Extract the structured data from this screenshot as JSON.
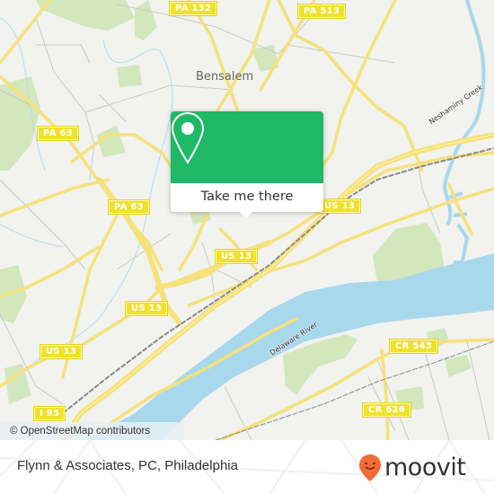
{
  "map": {
    "place_labels": [
      {
        "name": "Bensalem"
      }
    ],
    "water_labels": [
      {
        "name": "Neshaminy Creek"
      },
      {
        "name": "Delaware River"
      }
    ],
    "road_shields": [
      {
        "label": "PA 132"
      },
      {
        "label": "PA 513"
      },
      {
        "label": "PA 63"
      },
      {
        "label": "PA 63"
      },
      {
        "label": "US 13"
      },
      {
        "label": "US 13"
      },
      {
        "label": "US 13"
      },
      {
        "label": "US 13"
      },
      {
        "label": "I 95"
      },
      {
        "label": "CR 543"
      },
      {
        "label": "CR 626"
      }
    ],
    "attribution": "© OpenStreetMap contributors",
    "colors": {
      "land": "#f2f2ef",
      "water": "#a8d8ec",
      "park": "#cfe6b4",
      "road_major": "#f5e27a",
      "road_minor": "#c9c9c5",
      "rail": "#8a8a8a"
    }
  },
  "popup": {
    "icon": "map-pin-icon",
    "button_label": "Take me there",
    "accent_color": "#1fb866"
  },
  "footer": {
    "title": "Flynn & Associates, PC, Philadelphia",
    "brand": {
      "name": "moovit",
      "icon": "moovit-pin-smile-icon",
      "color": "#f26a35"
    }
  }
}
